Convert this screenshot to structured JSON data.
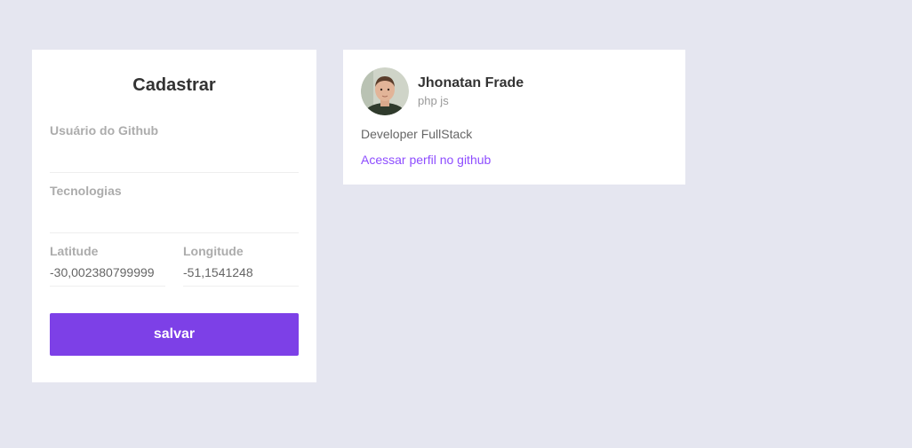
{
  "form": {
    "title": "Cadastrar",
    "github_user": {
      "label": "Usuário do Github",
      "value": ""
    },
    "techs": {
      "label": "Tecnologias",
      "value": ""
    },
    "latitude": {
      "label": "Latitude",
      "value": "-30,002380799999"
    },
    "longitude": {
      "label": "Longitude",
      "value": "-51,1541248"
    },
    "save_label": "salvar"
  },
  "dev": {
    "name": "Jhonatan Frade",
    "techs": "php js",
    "bio": "Developer FullStack",
    "link_label": "Acessar perfil no github"
  },
  "colors": {
    "background": "#e5e6f0",
    "accent": "#7d40e7",
    "link": "#8e4dff"
  }
}
